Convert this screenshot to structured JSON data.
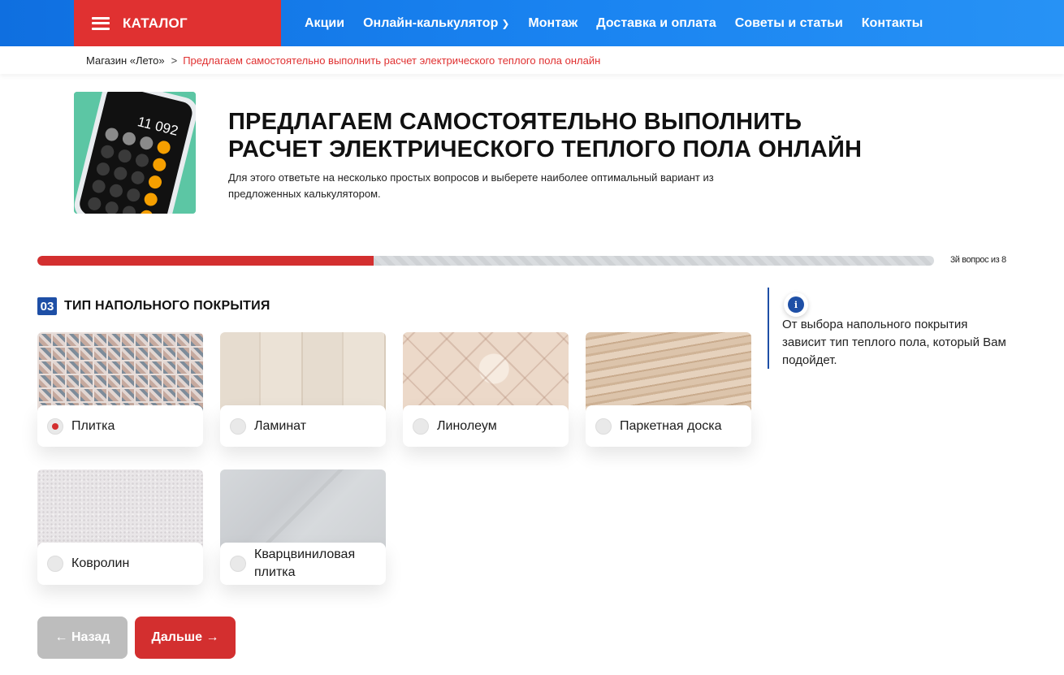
{
  "header": {
    "catalog_label": "КАТАЛОГ",
    "nav": [
      {
        "label": "Акции"
      },
      {
        "label": "Онлайн-калькулятор",
        "has_chevron": true
      },
      {
        "label": "Монтаж"
      },
      {
        "label": "Доставка и оплата"
      },
      {
        "label": "Советы и статьи"
      },
      {
        "label": "Контакты"
      }
    ]
  },
  "breadcrumb": {
    "home": "Магазин «Лето»",
    "separator": ">",
    "current": "Предлагаем самостоятельно выполнить расчет электрического теплого пола онлайн"
  },
  "hero": {
    "title": "ПРЕДЛАГАЕМ САМОСТОЯТЕЛЬНО ВЫПОЛНИТЬ РАСЧЕТ ЭЛЕКТРИЧЕСКОГО ТЕПЛОГО ПОЛА ОНЛАЙН",
    "subtitle": "Для этого ответьте на несколько простых вопросов и выберете наиболее оптимальный вариант из предложенных калькулятором.",
    "image_icon": "calculator-phone-image",
    "calculator_display": "11 092"
  },
  "progress": {
    "fraction": 0.375,
    "text": "3й вопрос из 8"
  },
  "question": {
    "number": "03",
    "title": "ТИП НАПОЛЬНОГО ПОКРЫТИЯ",
    "options": [
      {
        "label": "Плитка",
        "selected": true
      },
      {
        "label": "Ламинат",
        "selected": false
      },
      {
        "label": "Линолеум",
        "selected": false
      },
      {
        "label": "Паркетная доска",
        "selected": false
      },
      {
        "label": "Ковролин",
        "selected": false
      },
      {
        "label": "Кварцвиниловая плитка",
        "selected": false
      }
    ]
  },
  "info": {
    "icon": "info-icon",
    "icon_glyph": "i",
    "text": "От выбора напольного покрытия зависит тип теплого пола, который Вам подойдет."
  },
  "buttons": {
    "back_label": "← Назад",
    "next_label": "Дальше →"
  },
  "colors": {
    "brand_blue": "#1a84f1",
    "accent_red": "#d32f2f",
    "badge_blue": "#1e4fa6"
  }
}
